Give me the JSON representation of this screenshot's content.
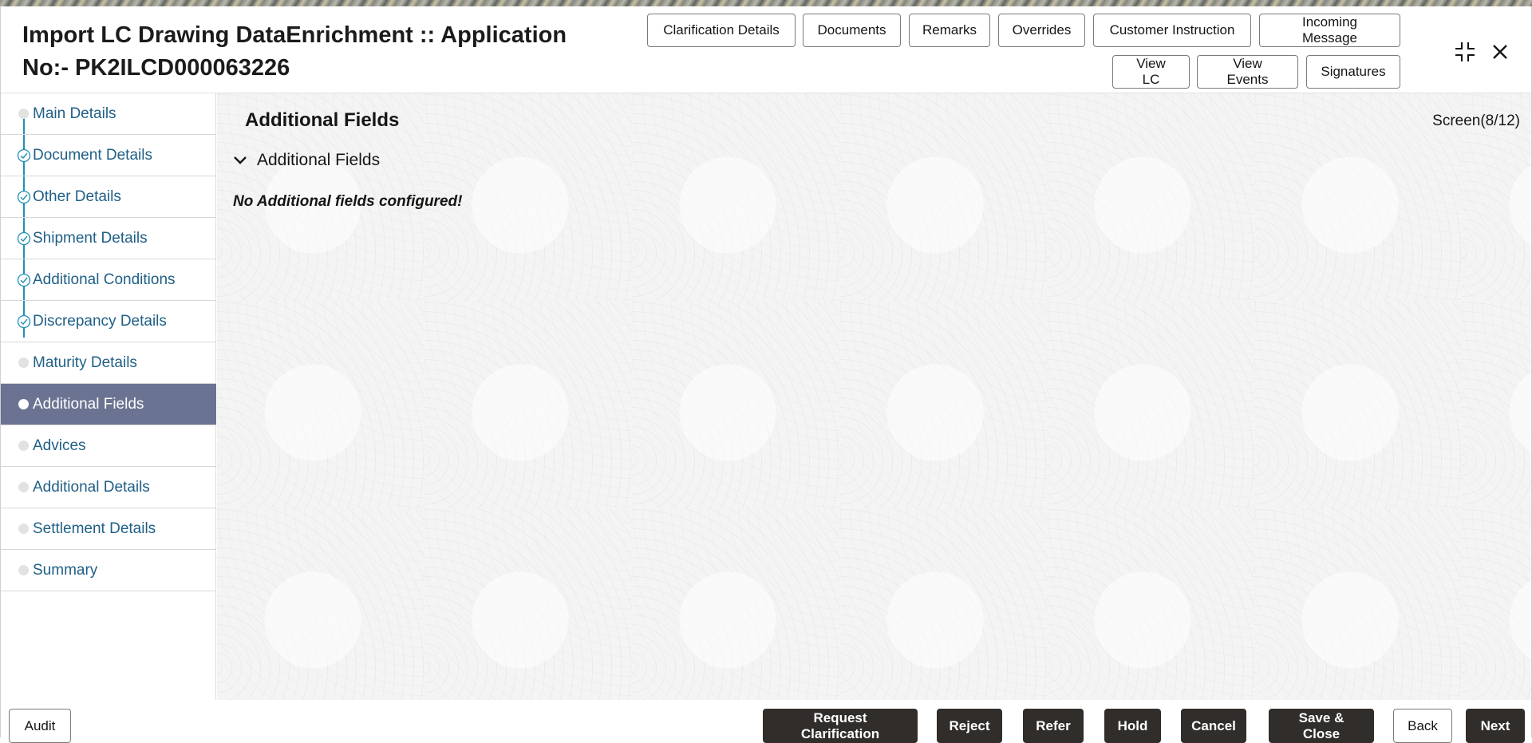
{
  "header": {
    "title_line1": "Import LC Drawing DataEnrichment :: Application",
    "title_line2": "No:- PK2ILCD000063226",
    "buttons_row1": [
      "Clarification Details",
      "Documents",
      "Remarks",
      "Overrides",
      "Customer Instruction",
      "Incoming Message"
    ],
    "buttons_row2": [
      "View LC",
      "View Events",
      "Signatures"
    ],
    "icons": [
      "compress-icon",
      "close-icon"
    ]
  },
  "sidebar": {
    "items": [
      {
        "label": "Main Details",
        "state": "pending"
      },
      {
        "label": "Document Details",
        "state": "done"
      },
      {
        "label": "Other Details",
        "state": "done"
      },
      {
        "label": "Shipment Details",
        "state": "done"
      },
      {
        "label": "Additional Conditions",
        "state": "done"
      },
      {
        "label": "Discrepancy Details",
        "state": "done"
      },
      {
        "label": "Maturity Details",
        "state": "pending"
      },
      {
        "label": "Additional Fields",
        "state": "active"
      },
      {
        "label": "Advices",
        "state": "pending"
      },
      {
        "label": "Additional Details",
        "state": "pending"
      },
      {
        "label": "Settlement Details",
        "state": "pending"
      },
      {
        "label": "Summary",
        "state": "pending"
      }
    ]
  },
  "main": {
    "section_title": "Additional Fields",
    "screen_count": "Screen(8/12)",
    "accordion_label": "Additional Fields",
    "empty_message": "No Additional fields configured!"
  },
  "footer": {
    "audit": "Audit",
    "request_clarification": "Request Clarification",
    "reject": "Reject",
    "refer": "Refer",
    "hold": "Hold",
    "cancel": "Cancel",
    "save_close": "Save & Close",
    "back": "Back",
    "next": "Next"
  },
  "colors": {
    "active_nav": "#6b7392",
    "nav_text": "#1f5f86",
    "rail": "#1f8fb4",
    "dark_button": "#312d2a"
  }
}
